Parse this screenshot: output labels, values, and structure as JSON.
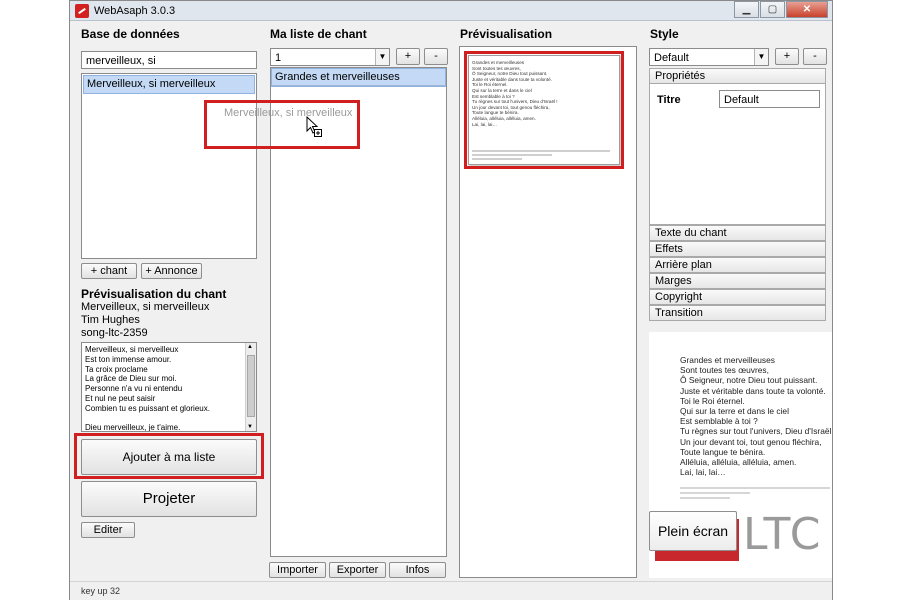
{
  "window": {
    "title": "WebAsaph 3.0.3",
    "min": "▁",
    "max": "▢",
    "close": "✕"
  },
  "db": {
    "title": "Base de données",
    "search_value": "merveilleux, si",
    "result_item": "Merveilleux, si merveilleux",
    "drag_ghost": "Merveilleux, si merveilleux",
    "add_song": "+ chant",
    "add_notice": "+ Annonce"
  },
  "song_preview": {
    "title": "Prévisualisation du chant",
    "song_name": "Merveilleux, si merveilleux",
    "author": "Tim Hughes",
    "song_id": "song-ltc-2359",
    "lyrics": [
      "Merveilleux, si merveilleux",
      "Est ton immense amour.",
      "Ta croix proclame",
      "La grâce de Dieu sur moi.",
      "Personne n'a vu ni entendu",
      "Et nul ne peut saisir",
      "Combien tu es puissant et glorieux.",
      "",
      "Dieu merveilleux, je t'aime."
    ],
    "add_to_list": "Ajouter à ma liste",
    "project": "Projeter",
    "edit": "Editer"
  },
  "mylist": {
    "title": "Ma liste de chant",
    "selector_value": "1",
    "plus": "+",
    "minus": "-",
    "item": "Grandes et merveilleuses",
    "import": "Importer",
    "export": "Exporter",
    "info": "Infos"
  },
  "preview": {
    "title": "Prévisualisation"
  },
  "style": {
    "title": "Style",
    "selector_value": "Default",
    "plus": "+",
    "minus": "-",
    "properties_header": "Propriétés",
    "titre_label": "Titre",
    "titre_value": "Default",
    "sections": [
      "Texte du chant",
      "Effets",
      "Arrière plan",
      "Marges",
      "Copyright",
      "Transition"
    ],
    "fullscreen": "Plein écran",
    "logo_text": "LTC"
  },
  "big_preview_lyrics": [
    "Grandes et merveilleuses",
    "Sont toutes tes œuvres,",
    "Ô Seigneur, notre Dieu tout puissant.",
    "Juste et véritable dans toute ta volonté.",
    "Toi le Roi éternel.",
    "Qui sur la terre et dans le ciel",
    "Est semblable à toi ?",
    "Tu règnes sur tout l'univers, Dieu d'Israël !",
    "Un jour devant toi, tout genou fléchira,",
    "Toute langue te bénira.",
    "Alléluia, alléluia, alléluia, amen.",
    "Lai, lai, lai…"
  ],
  "status": {
    "text": "key up 32"
  }
}
